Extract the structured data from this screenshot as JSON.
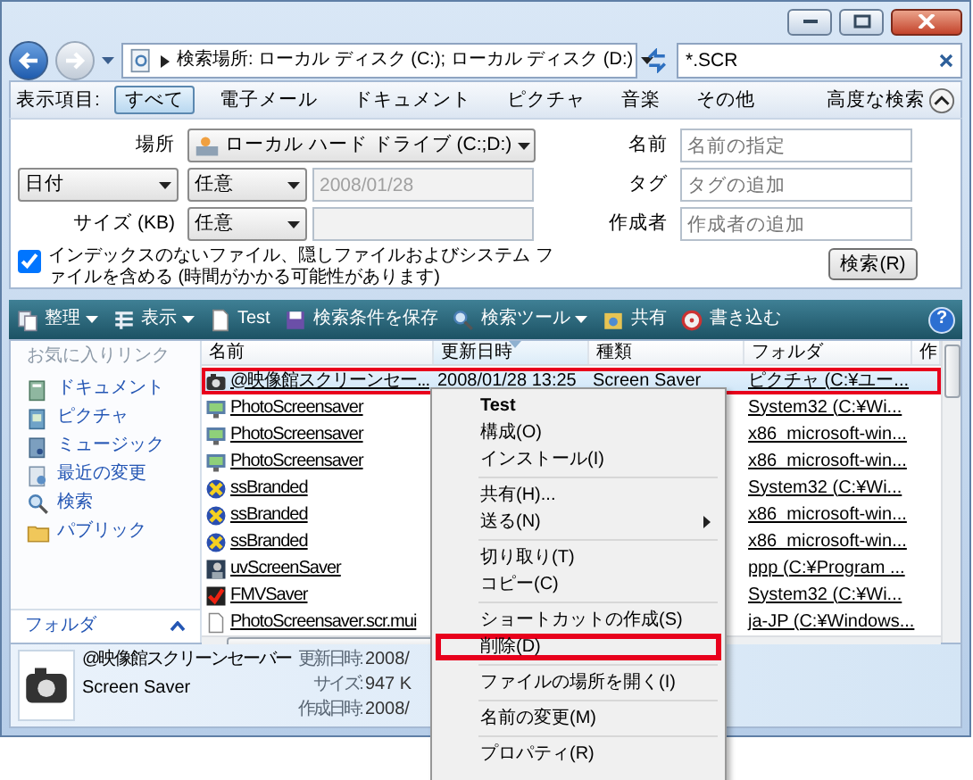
{
  "address_bar": {
    "path": "検索場所: ローカル ディスク (C:); ローカル ディスク (D:)"
  },
  "search_box": {
    "value": "*.SCR"
  },
  "filter_bar": {
    "label": "表示項目:",
    "advanced_search": "高度な検索",
    "tabs": [
      {
        "label": "すべて",
        "selected": true
      },
      {
        "label": "電子メール",
        "selected": false
      },
      {
        "label": "ドキュメント",
        "selected": false
      },
      {
        "label": "ピクチャ",
        "selected": false
      },
      {
        "label": "音楽",
        "selected": false
      },
      {
        "label": "その他",
        "selected": false
      }
    ]
  },
  "advanced_search": {
    "location": {
      "label": "場所",
      "value": "ローカル ハード ドライブ (C:;D:)"
    },
    "date": {
      "field": "日付",
      "condition": "任意",
      "value": "2008/01/28",
      "disabled": true
    },
    "size": {
      "label": "サイズ (KB)",
      "condition": "任意",
      "disabled": true
    },
    "fields": [
      {
        "label": "名前",
        "placeholder": "名前の指定"
      },
      {
        "label": "タグ",
        "placeholder": "タグの追加"
      },
      {
        "label": "作成者",
        "placeholder": "作成者の追加"
      }
    ],
    "include_unindexed": {
      "label": "インデックスのないファイル、隠しファイルおよびシステム ファイルを含める (時間がかかる可能性があります)",
      "checked": true
    },
    "search_button": "検索(R)"
  },
  "toolbar": {
    "help": "?",
    "items": [
      {
        "label": "整理",
        "kind": "organize",
        "dropdown": true
      },
      {
        "label": "表示",
        "kind": "views",
        "dropdown": true
      },
      {
        "label": "Test",
        "kind": "file",
        "dropdown": false
      },
      {
        "label": "検索条件を保存",
        "kind": "save",
        "dropdown": false
      },
      {
        "label": "検索ツール",
        "kind": "search",
        "dropdown": true
      },
      {
        "label": "共有",
        "kind": "share",
        "dropdown": false
      },
      {
        "label": "書き込む",
        "kind": "burn",
        "dropdown": false
      }
    ]
  },
  "favorite_links": {
    "title": "お気に入りリンク",
    "items": [
      {
        "label": "ドキュメント",
        "kind": "documents"
      },
      {
        "label": "ピクチャ",
        "kind": "pictures"
      },
      {
        "label": "ミュージック",
        "kind": "music"
      },
      {
        "label": "最近の変更",
        "kind": "recent"
      },
      {
        "label": "検索",
        "kind": "search"
      },
      {
        "label": "パブリック",
        "kind": "public"
      }
    ],
    "folders": "フォルダ"
  },
  "table": {
    "columns": [
      {
        "label": "名前",
        "sorted": false
      },
      {
        "label": "更新日時",
        "sorted": true
      },
      {
        "label": "種類",
        "sorted": false
      },
      {
        "label": "フォルダ",
        "sorted": false
      },
      {
        "label": "作",
        "sorted": false
      }
    ],
    "rows": [
      {
        "name": "@映像館スクリーンセー...",
        "modified": "2008/01/28 13:25",
        "type": "Screen Saver",
        "folder": "ピクチャ (C:¥ユー...",
        "kind": "camera",
        "selected": true,
        "highlighted": true
      },
      {
        "name": "PhotoScreensaver",
        "folder": "System32 (C:¥Wi...",
        "kind": "slideshow",
        "selected": false,
        "highlighted": false
      },
      {
        "name": "PhotoScreensaver",
        "folder": "x86_microsoft-win...",
        "kind": "slideshow",
        "selected": false,
        "highlighted": false
      },
      {
        "name": "PhotoScreensaver",
        "folder": "x86_microsoft-win...",
        "kind": "slideshow",
        "selected": false,
        "highlighted": false
      },
      {
        "name": "ssBranded",
        "folder": "System32 (C:¥Wi...",
        "kind": "ball",
        "selected": false,
        "highlighted": false
      },
      {
        "name": "ssBranded",
        "folder": "x86_microsoft-win...",
        "kind": "ball",
        "selected": false,
        "highlighted": false
      },
      {
        "name": "ssBranded",
        "folder": "x86_microsoft-win...",
        "kind": "ball",
        "selected": false,
        "highlighted": false
      },
      {
        "name": "uvScreenSaver",
        "folder": "ppp (C:¥Program ...",
        "kind": "portrait",
        "selected": false,
        "highlighted": false
      },
      {
        "name": "FMVSaver",
        "folder": "System32 (C:¥Wi...",
        "kind": "check",
        "selected": false,
        "highlighted": false
      },
      {
        "name": "PhotoScreensaver.scr.mui",
        "folder": "ja-JP (C:¥Windows...",
        "kind": "file",
        "selected": false,
        "highlighted": false
      }
    ]
  },
  "details": {
    "title": "@映像館スクリーンセーバー",
    "type": "Screen Saver",
    "fields": [
      {
        "label": "更新日時:",
        "value": "2008/"
      },
      {
        "label": "サイズ:",
        "value": "947 K"
      },
      {
        "label": "作成日時:",
        "value": "2008/"
      }
    ]
  },
  "context_menu": {
    "items": [
      {
        "kind": "item",
        "label": "Test",
        "default": true,
        "submenu": false,
        "highlighted": false
      },
      {
        "kind": "item",
        "label": "構成(O)",
        "default": false,
        "submenu": false,
        "highlighted": false
      },
      {
        "kind": "item",
        "label": "インストール(I)",
        "default": false,
        "submenu": false,
        "highlighted": false
      },
      {
        "kind": "separator"
      },
      {
        "kind": "item",
        "label": "共有(H)...",
        "default": false,
        "submenu": false,
        "highlighted": false
      },
      {
        "kind": "item",
        "label": "送る(N)",
        "default": false,
        "submenu": true,
        "highlighted": false
      },
      {
        "kind": "separator"
      },
      {
        "kind": "item",
        "label": "切り取り(T)",
        "default": false,
        "submenu": false,
        "highlighted": false
      },
      {
        "kind": "item",
        "label": "コピー(C)",
        "default": false,
        "submenu": false,
        "highlighted": false
      },
      {
        "kind": "separator"
      },
      {
        "kind": "item",
        "label": "ショートカットの作成(S)",
        "default": false,
        "submenu": false,
        "highlighted": false
      },
      {
        "kind": "item",
        "label": "削除(D)",
        "default": false,
        "submenu": false,
        "highlighted": true
      },
      {
        "kind": "separator"
      },
      {
        "kind": "item",
        "label": "ファイルの場所を開く(I)",
        "default": false,
        "submenu": false,
        "highlighted": false
      },
      {
        "kind": "separator"
      },
      {
        "kind": "item",
        "label": "名前の変更(M)",
        "default": false,
        "submenu": false,
        "highlighted": false
      },
      {
        "kind": "separator"
      },
      {
        "kind": "item",
        "label": "プロパティ(R)",
        "default": false,
        "submenu": false,
        "highlighted": false
      }
    ]
  }
}
